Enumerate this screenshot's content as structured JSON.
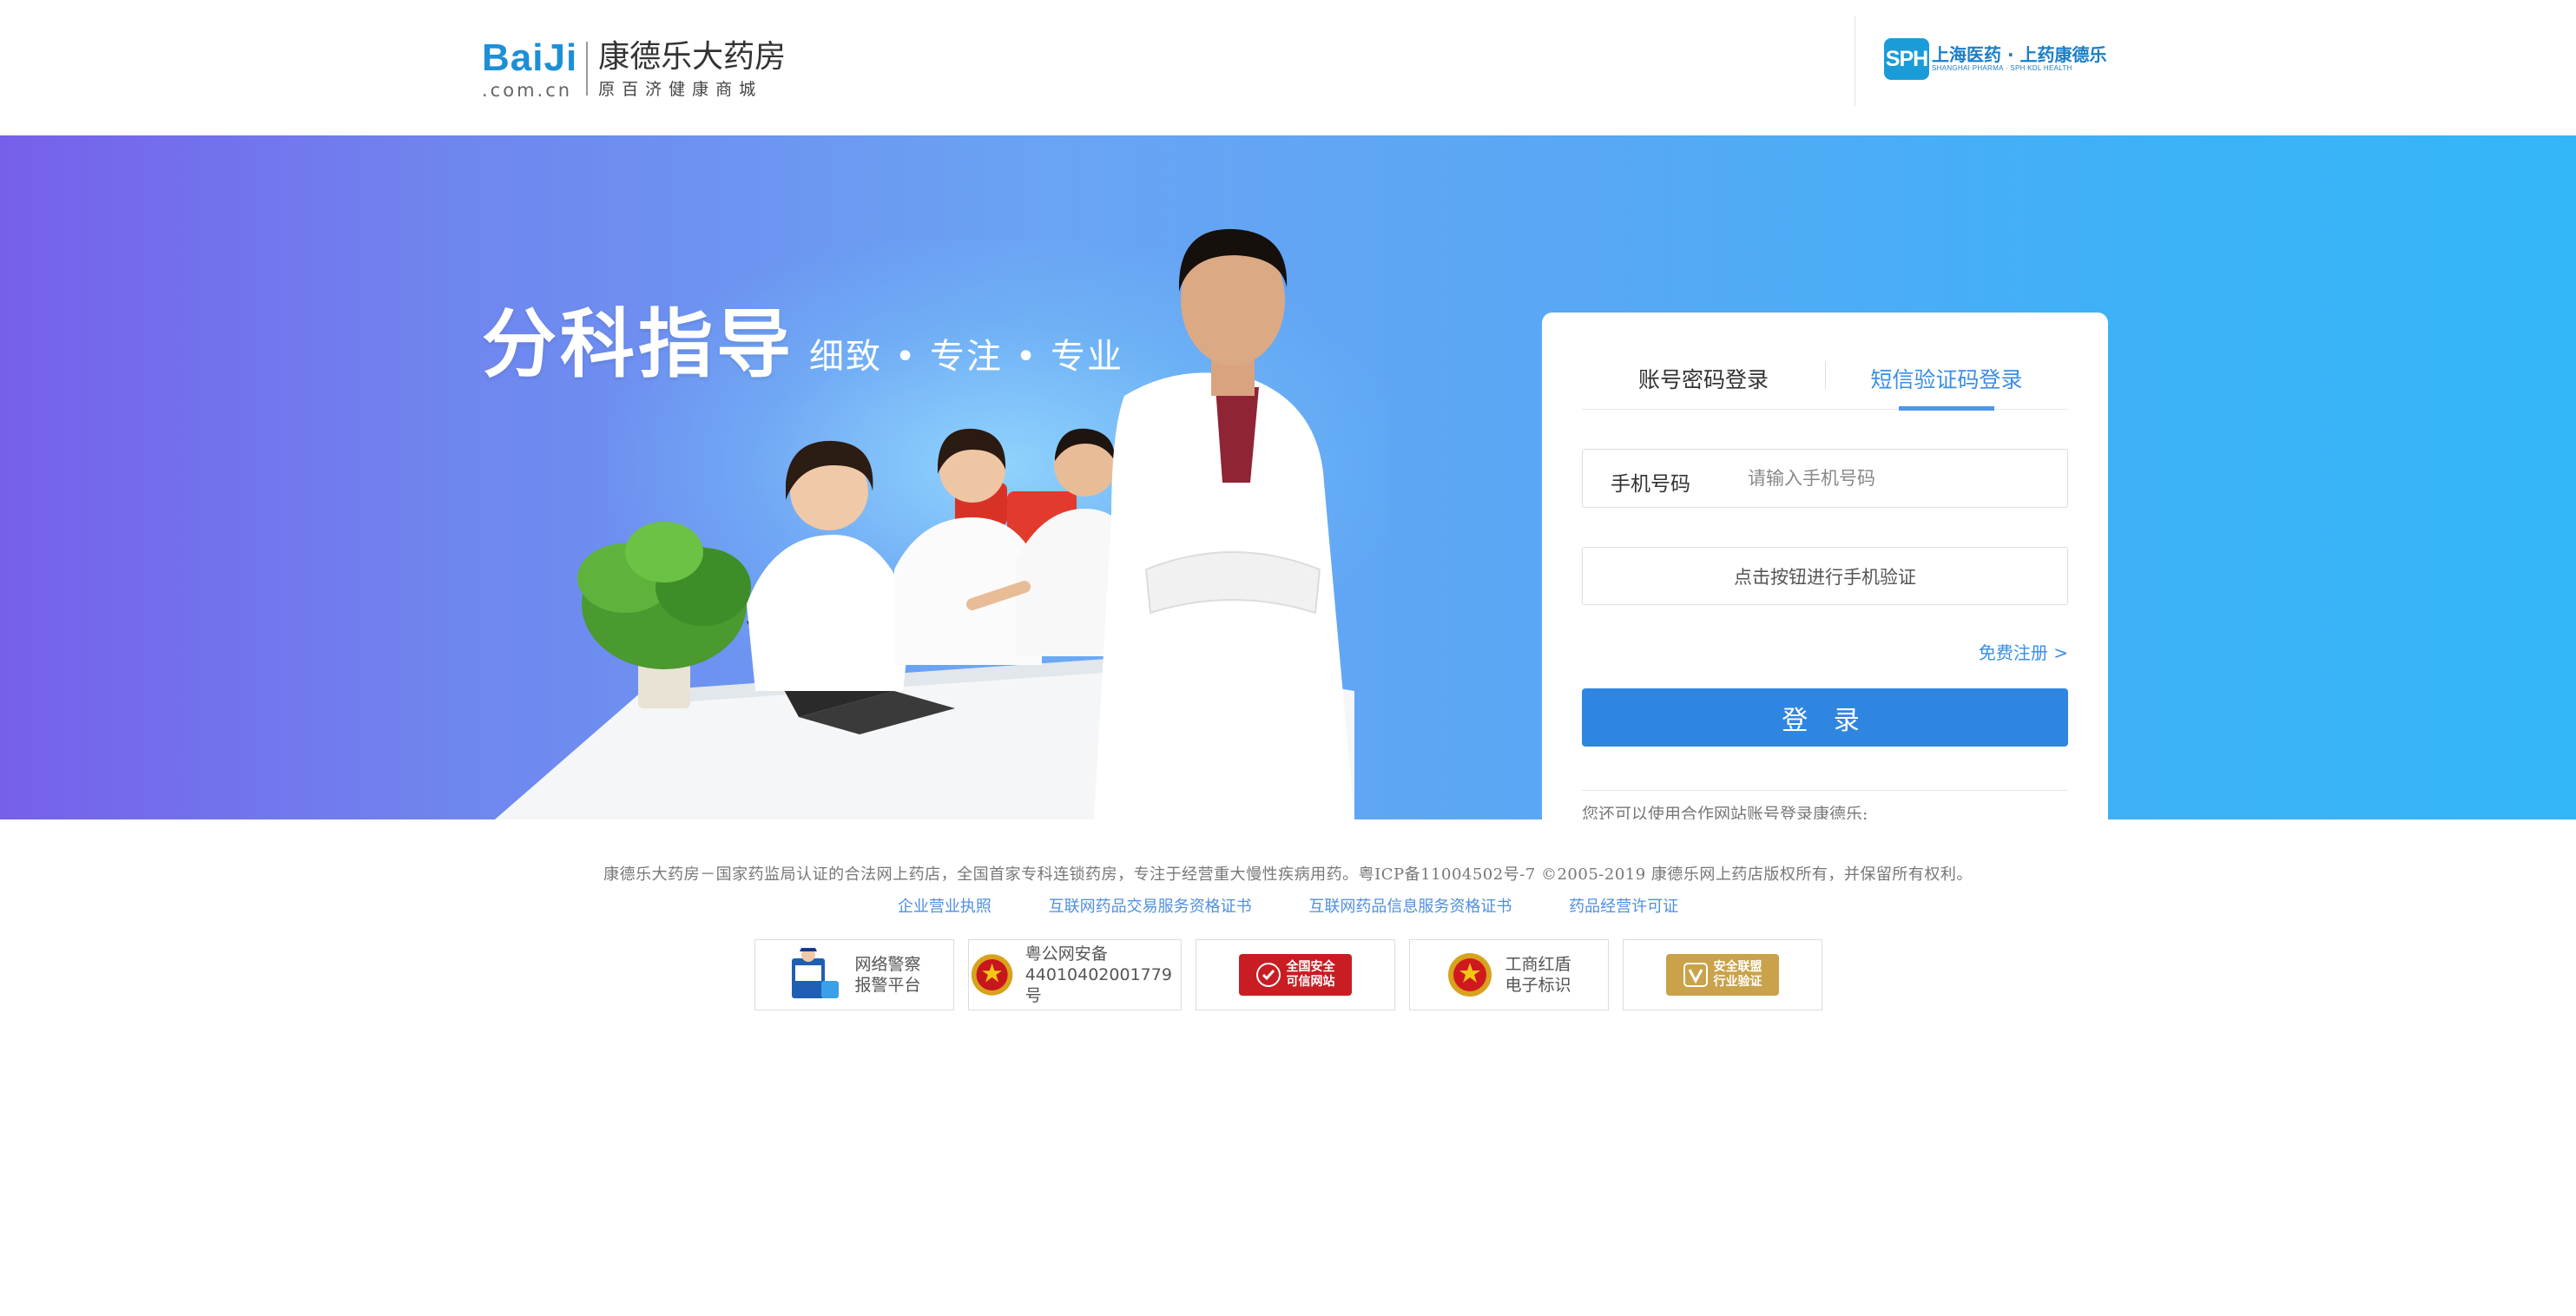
{
  "header": {
    "logo_en": "BaiJi",
    "logo_domain": ".com.cn",
    "logo_name": "康德乐大药房",
    "logo_slogan": "原百济健康商城",
    "partner_logo_mark": "SPH",
    "partner_logo_cn": "上海医药 · 上药康德乐",
    "partner_logo_en": "SHANGHAI PHARMA · SPH KDL HEALTH"
  },
  "banner": {
    "headline": "分科指导",
    "tagline": "细致 • 专注 • 专业"
  },
  "login": {
    "tabs": [
      "账号密码登录",
      "短信验证码登录"
    ],
    "active_tab": 1,
    "phone_label": "手机号码",
    "phone_placeholder": "请输入手机号码",
    "phone_value": "",
    "verify_button": "点击按钮进行手机验证",
    "register_link": "免费注册 >",
    "login_button": "登 录",
    "partner_text": "您还可以使用合作网站账号登录康德乐:",
    "social": [
      {
        "name": "qq-icon"
      },
      {
        "name": "weibo-icon"
      },
      {
        "name": "wechat-icon"
      }
    ]
  },
  "footer": {
    "copyright": "康德乐大药房－国家药监局认证的合法网上药店，全国首家专科连锁药房，专注于经营重大慢性疾病用药。粤ICP备11004502号-7 ©2005-2019 康德乐网上药店版权所有，并保留所有权利。",
    "links": [
      "企业营业执照",
      "互联网药品交易服务资格证书",
      "互联网药品信息服务资格证书",
      "药品经营许可证"
    ],
    "badges": {
      "police": [
        "网络警察",
        "报警平台"
      ],
      "beian": [
        "粤公网安备",
        "44010402001779号"
      ],
      "safe": [
        "全国安全",
        "可信网站"
      ],
      "icbc": [
        "工商红盾",
        "电子标识"
      ],
      "alliance": [
        "安全联盟",
        "行业验证"
      ]
    }
  },
  "colors": {
    "accent": "#2f86e0",
    "link": "#3a8ee6",
    "banner_left": "#7660ea",
    "banner_right": "#33b6f8"
  }
}
